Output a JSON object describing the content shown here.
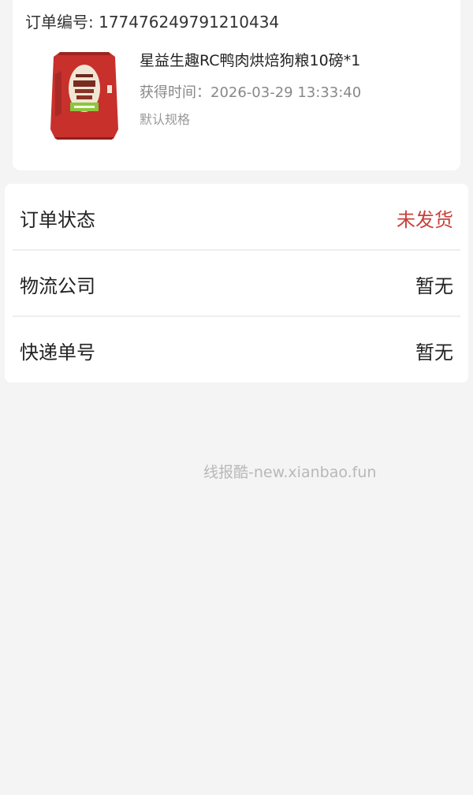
{
  "order": {
    "order_number_text": "订单编号: 177476249791210434",
    "product": {
      "name": "星益生趣RC鸭肉烘焙狗粮10磅*1",
      "time_text": "获得时间：2026-03-29 13:33:40",
      "spec": "默认规格",
      "image_name": "dog-food-bag-image",
      "bag_color": "#c8302c"
    }
  },
  "status": {
    "rows": [
      {
        "label": "订单状态",
        "value": "未发货",
        "value_color": "#c9413a"
      },
      {
        "label": "物流公司",
        "value": "暂无"
      },
      {
        "label": "快递单号",
        "value": "暂无"
      }
    ]
  },
  "watermark": "线报酷-new.xianbao.fun"
}
